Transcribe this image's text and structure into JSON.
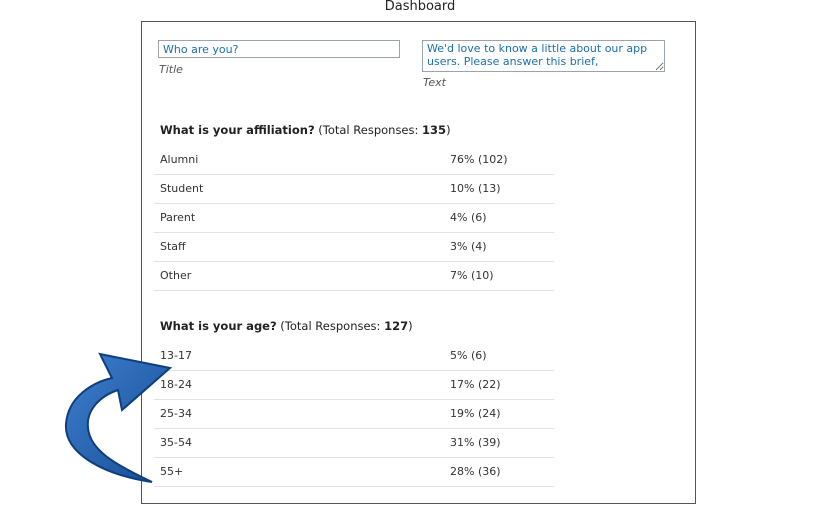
{
  "window": {
    "title": "Dashboard"
  },
  "form": {
    "title_field": {
      "value": "Who are you?",
      "caption": "Title"
    },
    "text_field": {
      "value": "We'd love to know a little about our app users. Please answer this brief, anonymous",
      "caption": "Text"
    }
  },
  "sections": [
    {
      "question": "What is your affiliation?",
      "total_label": " (Total Responses: ",
      "total": "135",
      "close": ")",
      "rows": [
        {
          "label": "Alumni",
          "value": "76% (102)"
        },
        {
          "label": "Student",
          "value": "10% (13)"
        },
        {
          "label": "Parent",
          "value": "4% (6)"
        },
        {
          "label": "Staff",
          "value": "3% (4)"
        },
        {
          "label": "Other",
          "value": "7% (10)"
        }
      ]
    },
    {
      "question": "What is your age?",
      "total_label": " (Total Responses: ",
      "total": "127",
      "close": ")",
      "rows": [
        {
          "label": "13-17",
          "value": "5% (6)"
        },
        {
          "label": "18-24",
          "value": "17% (22)"
        },
        {
          "label": "25-34",
          "value": "19% (24)"
        },
        {
          "label": "35-54",
          "value": "31% (39)"
        },
        {
          "label": "55+",
          "value": "28% (36)"
        }
      ]
    }
  ],
  "annotation": {
    "icon": "curved-arrow-icon",
    "color": "#1e5fae"
  }
}
